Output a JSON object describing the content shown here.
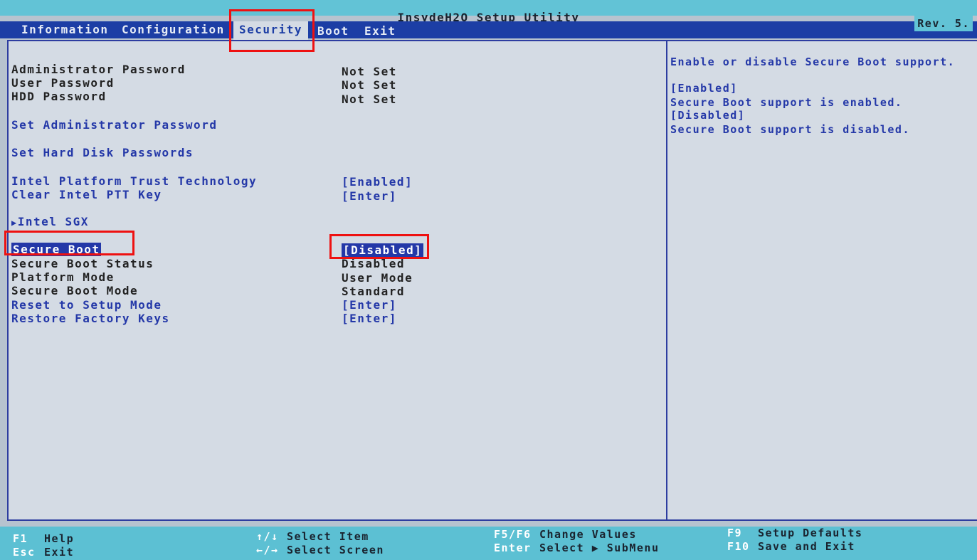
{
  "window": {
    "title": "InsydeH2O Setup Utility",
    "rev": "Rev. 5."
  },
  "tabs": [
    {
      "label": "Information"
    },
    {
      "label": "Configuration"
    },
    {
      "label": "Security",
      "active": true
    },
    {
      "label": "Boot"
    },
    {
      "label": "Exit"
    }
  ],
  "items": {
    "admin_password": {
      "label": "Administrator Password",
      "value": "Not Set"
    },
    "user_password": {
      "label": "User Password",
      "value": "Not Set"
    },
    "hdd_password": {
      "label": "HDD Password",
      "value": "Not Set"
    },
    "set_admin_password": {
      "label": "Set Administrator Password"
    },
    "set_hdd_passwords": {
      "label": "Set Hard Disk Passwords"
    },
    "intel_ptt": {
      "label": "Intel Platform Trust Technology",
      "value": "[Enabled]"
    },
    "clear_ptt_key": {
      "label": "Clear Intel PTT Key",
      "value": "[Enter]"
    },
    "intel_sgx": {
      "label": "Intel SGX",
      "arrow": "▶"
    },
    "secure_boot": {
      "label": "Secure Boot",
      "value": "[Disabled]"
    },
    "secure_boot_status": {
      "label": "Secure Boot Status",
      "value": "Disabled"
    },
    "platform_mode": {
      "label": "Platform Mode",
      "value": "User Mode"
    },
    "secure_boot_mode": {
      "label": "Secure Boot Mode",
      "value": "Standard"
    },
    "reset_setup_mode": {
      "label": "Reset to Setup Mode",
      "value": "[Enter]"
    },
    "restore_factory_keys": {
      "label": "Restore Factory Keys",
      "value": "[Enter]"
    }
  },
  "help": {
    "line1": "Enable or disable Secure Boot support.",
    "line2": "[Enabled]",
    "line3": "Secure Boot support is enabled.",
    "line4": "[Disabled]",
    "line5": "Secure Boot support is disabled."
  },
  "footer": {
    "f1_key": "F1",
    "f1_desc": "Help",
    "esc_key": "Esc",
    "esc_desc": "Exit",
    "updown_key": "↑/↓",
    "updown_desc": "Select Item",
    "leftright_key": "←/→",
    "leftright_desc": "Select Screen",
    "f5f6_key": "F5/F6",
    "f5f6_desc": "Change Values",
    "enter_key": "Enter",
    "enter_desc": "Select ▶ SubMenu",
    "f9_key": "F9",
    "f9_desc": "Setup Defaults",
    "f10_key": "F10",
    "f10_desc": "Save and Exit"
  },
  "colors": {
    "background": "#d4dbe4",
    "menubar": "#1c3ea5",
    "titlebar": "#62c3d6",
    "link_text": "#2438a8",
    "annotation": "#ee1111"
  }
}
